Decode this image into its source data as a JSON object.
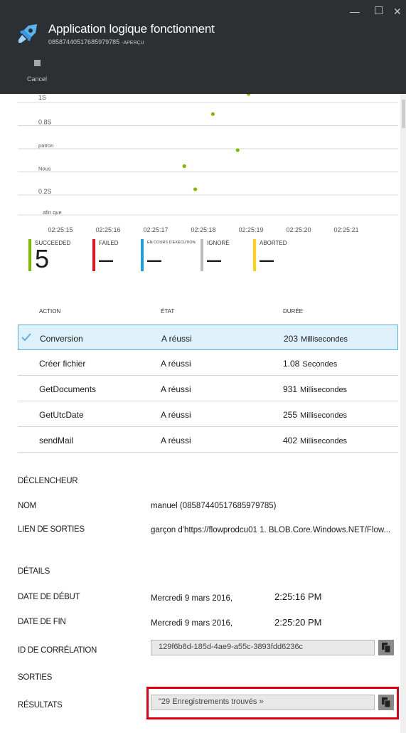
{
  "window": {
    "minimize_glyph": "—",
    "maximize_glyph": "☐",
    "close_glyph": "✕"
  },
  "header": {
    "title": "Application logique fonctionnent",
    "run_id": "08587440517685979785",
    "tag": "-APERÇU",
    "icon": "rocket-icon",
    "cancel_label": "Cancel"
  },
  "chart_data": {
    "type": "scatter",
    "ytick_labels": [
      "1S",
      "0.8S",
      "patron",
      "Nous",
      "0.2S",
      "afin que"
    ],
    "xtick_labels": [
      "02:25:15",
      "02:25:16",
      "02:25:17",
      "02:25:18",
      "02:25:19",
      "02:25:20",
      "02:25:21"
    ],
    "x_range": [
      0,
      6
    ],
    "y_range": [
      0,
      1
    ],
    "points": [
      {
        "x": 2.6,
        "y": 0.28
      },
      {
        "x": 2.83,
        "y": 0.05
      },
      {
        "x": 3.2,
        "y": 0.8
      },
      {
        "x": 3.72,
        "y": 0.44
      },
      {
        "x": 3.95,
        "y": 1.0
      }
    ],
    "point_color": "#7fba00",
    "grid": true
  },
  "statuses": [
    {
      "label": "SUCCEEDED",
      "value": "5",
      "color": "#7fba00"
    },
    {
      "label": "FAILED",
      "value": "–",
      "color": "#e81123"
    },
    {
      "label": "EN COURS D'EXÉCUTION",
      "value": "–",
      "color": "#1ba1e2"
    },
    {
      "label": "IGNORÉ",
      "value": "–",
      "color": "#bababa"
    },
    {
      "label": "ABORTED",
      "value": "–",
      "color": "#fcd116"
    }
  ],
  "table": {
    "headers": {
      "action": "ACTION",
      "state": "ÉTAT",
      "duration": "DURÉE"
    },
    "rows": [
      {
        "action": "Conversion",
        "state": "A réussi",
        "duration": "203",
        "unit": "Millisecondes"
      },
      {
        "action": "Créer fichier",
        "state": "A réussi",
        "duration": "1.08",
        "unit": "Secondes"
      },
      {
        "action": "GetDocuments",
        "state": "A réussi",
        "duration": "931",
        "unit": "Millisecondes"
      },
      {
        "action": "GetUtcDate",
        "state": "A réussi",
        "duration": "255",
        "unit": "Millisecondes"
      },
      {
        "action": "sendMail",
        "state": "A réussi",
        "duration": "402",
        "unit": "Millisecondes"
      }
    ]
  },
  "trigger": {
    "section_title": "DÉCLENCHEUR",
    "name_label": "NOM",
    "name_value": "manuel (08587440517685979785)",
    "outputs_link_label": "LIEN DE SORTIES",
    "outputs_link_value": "garçon d'https://flowprodcu01 1. BLOB.Core.Windows.NET/Flow..."
  },
  "details": {
    "section_title": "DÉTAILS",
    "start_label": "DATE DE DÉBUT",
    "start_date": "Mercredi 9 mars 2016,",
    "start_time": "2:25:16 PM",
    "end_label": "DATE DE FIN",
    "end_date": "Mercredi 9 mars 2016,",
    "end_time": "2:25:20 PM",
    "correlation_label": "ID DE CORRÉLATION",
    "correlation_value": "129f6b8d-185d-4ae9-a55c-3893fdd6236c",
    "outputs_label": "SORTIES",
    "results_label": "RÉSULTATS",
    "results_value": "\"29 Enregistrements trouvés »"
  }
}
